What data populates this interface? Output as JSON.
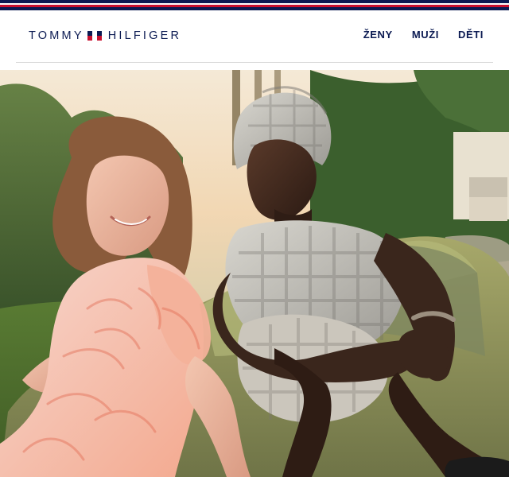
{
  "header": {
    "brand_left": "TOMMY",
    "brand_right": "HILFIGER",
    "nav": [
      {
        "label": "ŽENY"
      },
      {
        "label": "MUŽI"
      },
      {
        "label": "DĚTI"
      }
    ]
  },
  "colors": {
    "navy": "#0b1a52",
    "red": "#c8102e",
    "white": "#ffffff"
  },
  "hero": {
    "image_icon": "hero-image"
  }
}
